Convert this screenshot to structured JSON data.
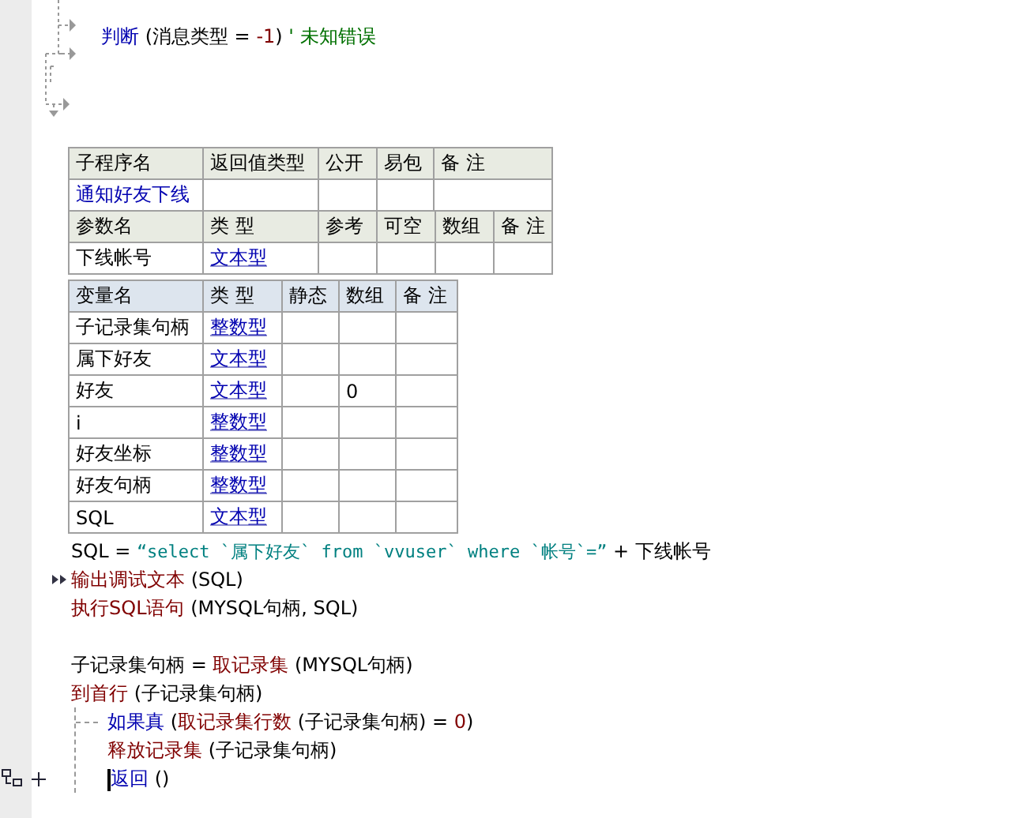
{
  "top_line": [
    {
      "text": "判断",
      "kind": "keyword"
    },
    {
      "text": " (消息类型 = ",
      "kind": "plain"
    },
    {
      "text": "-1",
      "kind": "number"
    },
    {
      "text": ") ",
      "kind": "plain"
    },
    {
      "text": "' 未知错误",
      "kind": "comment"
    }
  ],
  "subroutine_table": {
    "columns": [
      "子程序名",
      "返回值类型",
      "公开",
      "易包",
      "备 注"
    ],
    "name": "通知好友下线"
  },
  "param_table": {
    "columns": [
      "参数名",
      "类 型",
      "参考",
      "可空",
      "数组",
      "备 注"
    ],
    "rows": [
      {
        "name": "下线帐号",
        "type": "文本型"
      }
    ]
  },
  "variable_table": {
    "columns": [
      "变量名",
      "类 型",
      "静态",
      "数组",
      "备 注"
    ],
    "rows": [
      {
        "name": "子记录集句柄",
        "type": "整数型"
      },
      {
        "name": "属下好友",
        "type": "文本型"
      },
      {
        "name": "好友",
        "type": "文本型",
        "array": "0"
      },
      {
        "name": "i",
        "type": "整数型"
      },
      {
        "name": "好友坐标",
        "type": "整数型"
      },
      {
        "name": "好友句柄",
        "type": "整数型"
      },
      {
        "name": "SQL",
        "type": "文本型"
      }
    ]
  },
  "code": [
    {
      "kind": "line",
      "tokens": [
        {
          "text": "SQL = ",
          "kind": "plain"
        },
        {
          "text": "“select `属下好友` from `vvuser` where `帐号`=”",
          "kind": "string"
        },
        {
          "text": " + 下线帐号",
          "kind": "plain"
        }
      ]
    },
    {
      "kind": "line",
      "breakpoint": true,
      "tokens": [
        {
          "text": "输出调试文本",
          "kind": "command"
        },
        {
          "text": " (SQL)",
          "kind": "plain"
        }
      ]
    },
    {
      "kind": "line",
      "tokens": [
        {
          "text": "执行SQL语句",
          "kind": "command"
        },
        {
          "text": " (MYSQL句柄, SQL)",
          "kind": "plain"
        }
      ]
    },
    {
      "kind": "blank"
    },
    {
      "kind": "line",
      "tokens": [
        {
          "text": "子记录集句柄 = ",
          "kind": "plain"
        },
        {
          "text": "取记录集",
          "kind": "command"
        },
        {
          "text": " (MYSQL句柄)",
          "kind": "plain"
        }
      ]
    },
    {
      "kind": "line",
      "tokens": [
        {
          "text": "到首行",
          "kind": "command"
        },
        {
          "text": " (子记录集句柄)",
          "kind": "plain"
        }
      ]
    },
    {
      "kind": "block",
      "tokens": [
        {
          "text": "如果真",
          "kind": "keyword"
        },
        {
          "text": " (",
          "kind": "plain"
        },
        {
          "text": "取记录集行数",
          "kind": "command"
        },
        {
          "text": " (子记录集句柄) = ",
          "kind": "plain"
        },
        {
          "text": "0",
          "kind": "number"
        },
        {
          "text": ")",
          "kind": "plain"
        }
      ],
      "children": [
        {
          "kind": "line",
          "tokens": [
            {
              "text": "释放记录集",
              "kind": "command"
            },
            {
              "text": " (子记录集句柄)",
              "kind": "plain"
            }
          ]
        },
        {
          "kind": "line",
          "cursor": true,
          "fold_marker": true,
          "tokens": [
            {
              "text": "返回",
              "kind": "keyword"
            },
            {
              "text": " ()",
              "kind": "plain"
            }
          ]
        }
      ]
    }
  ]
}
